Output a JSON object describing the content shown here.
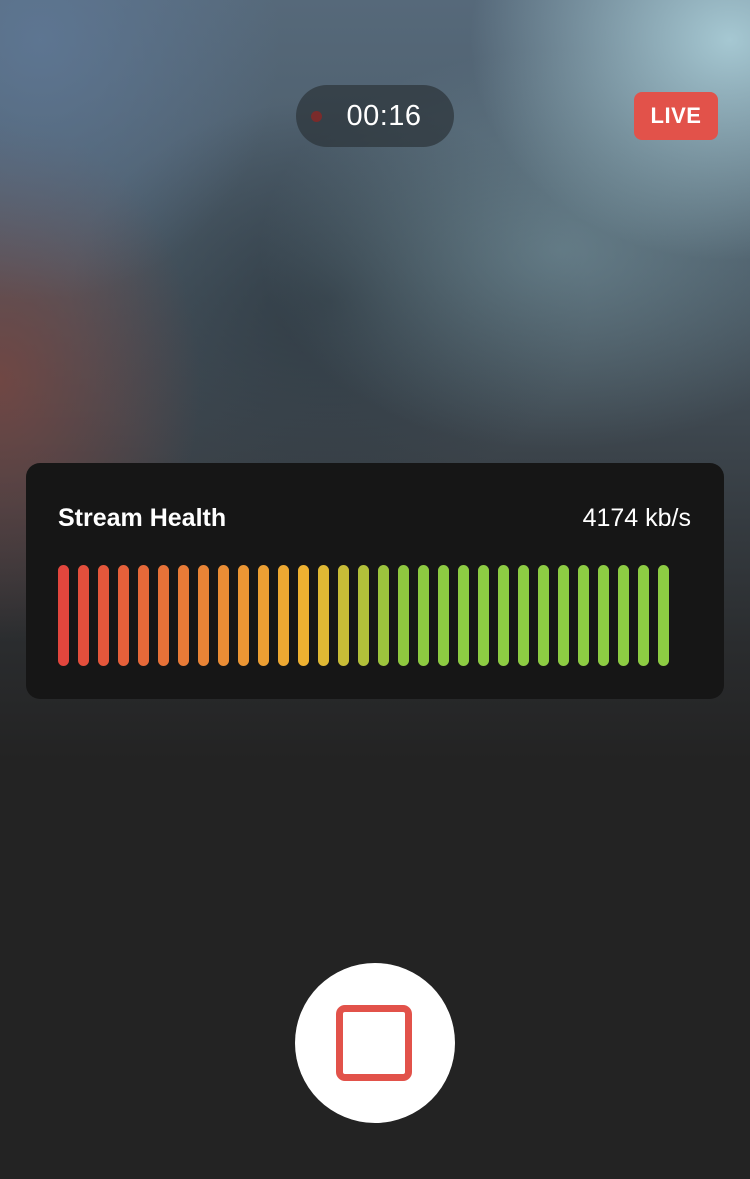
{
  "recording": {
    "elapsed": "00:16",
    "dot_color": "#7a2b2b"
  },
  "live_badge": {
    "label": "LIVE",
    "color": "#e2524a"
  },
  "stream_health": {
    "title": "Stream Health",
    "bitrate": "4174 kb/s",
    "meter": {
      "bars_lit": 31,
      "bars_total": 31,
      "colors": [
        "#e2463d",
        "#e34f3c",
        "#e4573b",
        "#e5603a",
        "#e66939",
        "#e77238",
        "#e87b37",
        "#e98436",
        "#ea8d35",
        "#eb9634",
        "#ec9f33",
        "#eda832",
        "#eeb131",
        "#dfb834",
        "#c8bc37",
        "#b2c03a",
        "#9cc43d",
        "#8fc83f",
        "#8dca41",
        "#8dcb42",
        "#8dcc43",
        "#8dcc43",
        "#8dcc43",
        "#8dcc43",
        "#8dcc43",
        "#8dcc43",
        "#8dcc43",
        "#8dcc43",
        "#8dcc43",
        "#8dcc43",
        "#8dcc43"
      ]
    }
  },
  "controls": {
    "stop_icon": "stop-square-icon",
    "stop_color": "#e2524a"
  }
}
